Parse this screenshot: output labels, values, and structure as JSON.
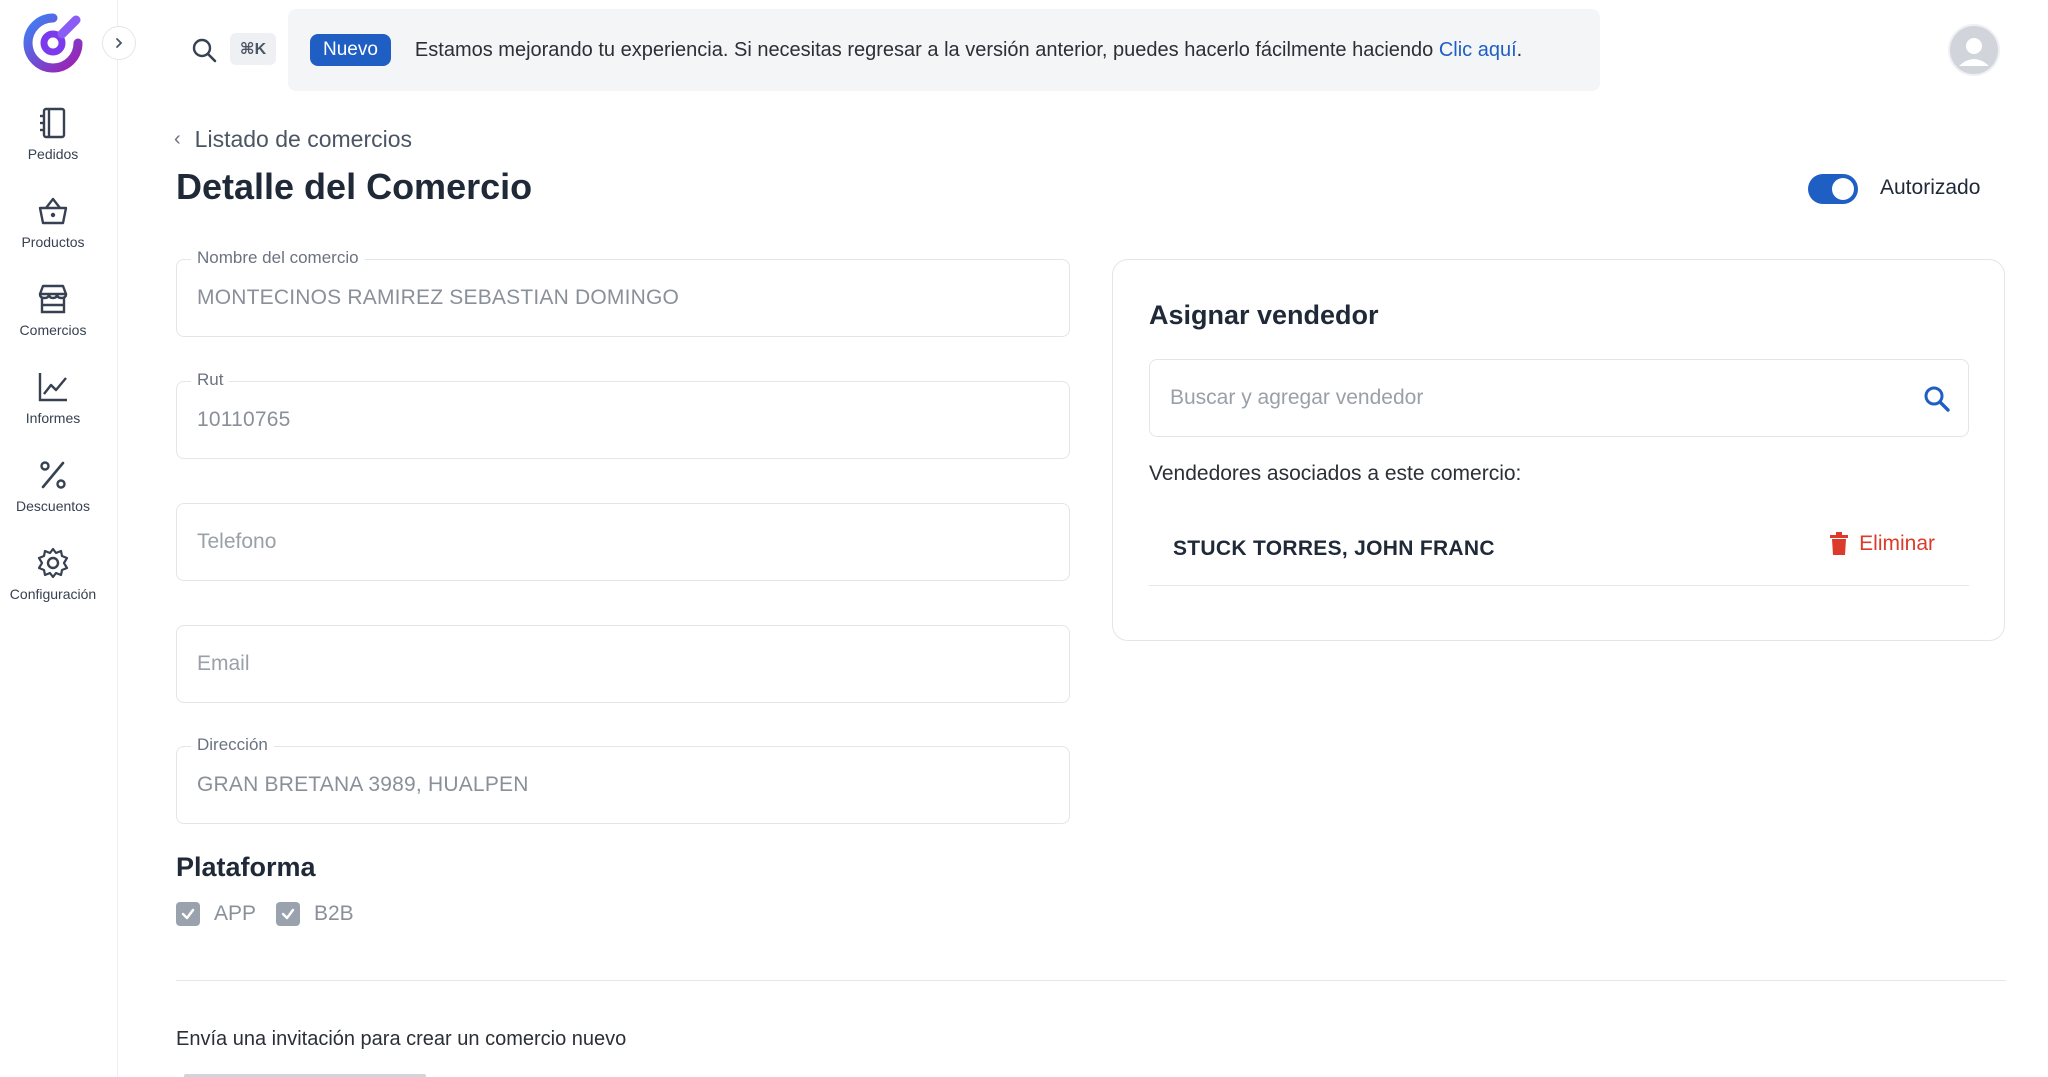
{
  "sidebar": {
    "items": [
      {
        "label": "Pedidos",
        "icon": "notebook-icon"
      },
      {
        "label": "Productos",
        "icon": "basket-icon"
      },
      {
        "label": "Comercios",
        "icon": "store-icon"
      },
      {
        "label": "Informes",
        "icon": "chart-line-icon"
      },
      {
        "label": "Descuentos",
        "icon": "percent-icon"
      },
      {
        "label": "Configuración",
        "icon": "gear-icon"
      }
    ]
  },
  "topbar": {
    "shortcut": "⌘K",
    "banner": {
      "badge": "Nuevo",
      "text": "Estamos mejorando tu experiencia. Si necesitas regresar a la versión anterior, puedes hacerlo fácilmente haciendo ",
      "link": "Clic aquí",
      "suffix": "."
    }
  },
  "header": {
    "breadcrumb": "Listado de comercios",
    "title": "Detalle del Comercio",
    "toggle_label": "Autorizado",
    "toggle_on": true
  },
  "form": {
    "nombre": {
      "label": "Nombre del comercio",
      "value": "MONTECINOS RAMIREZ SEBASTIAN DOMINGO"
    },
    "rut": {
      "label": "Rut",
      "value": "10110765"
    },
    "telefono": {
      "placeholder": "Telefono"
    },
    "email": {
      "placeholder": "Email"
    },
    "direccion": {
      "label": "Dirección",
      "value": "GRAN BRETANA 3989, HUALPEN"
    }
  },
  "plataforma": {
    "title": "Plataforma",
    "options": [
      {
        "label": "APP",
        "checked": true
      },
      {
        "label": "B2B",
        "checked": true
      }
    ]
  },
  "vendor_card": {
    "title": "Asignar vendedor",
    "search_placeholder": "Buscar y agregar vendedor",
    "assoc_label": "Vendedores asociados a este comercio:",
    "vendors": [
      {
        "name": "STUCK TORRES, JOHN FRANC",
        "action": "Eliminar"
      }
    ]
  },
  "invite": {
    "text": "Envía una invitación para crear un comercio nuevo"
  },
  "colors": {
    "accent": "#1f5fc4",
    "danger": "#dc3a2a",
    "logo_gradient_start": "#3b82f6",
    "logo_gradient_end": "#a21caf"
  }
}
